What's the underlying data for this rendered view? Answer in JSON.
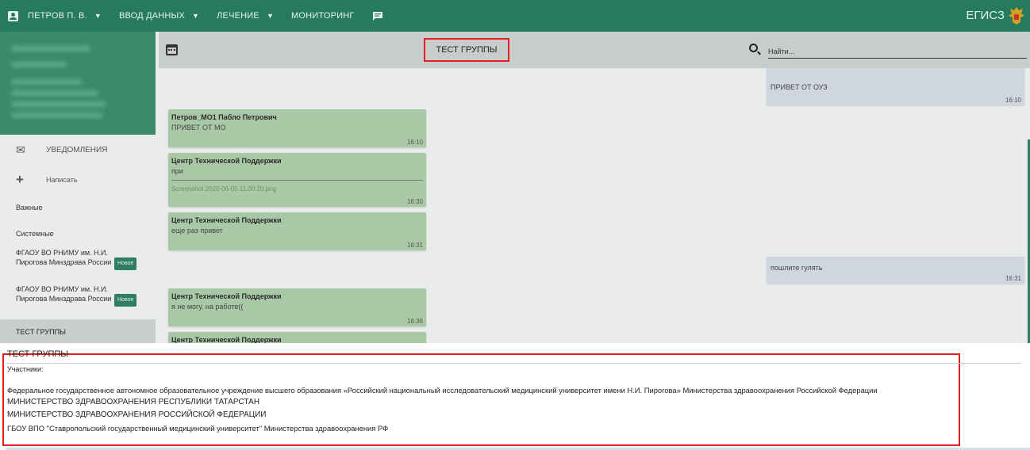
{
  "colors": {
    "nav": "#267a5e",
    "accent": "#2f7d62",
    "highlight": "#e02020",
    "incoming": "#a9c9a6",
    "outgoing": "#cfd6e0"
  },
  "nav": {
    "user": "ПЕТРОВ П. В.",
    "input": "ВВОД ДАННЫХ",
    "treatment": "ЛЕЧЕНИЕ",
    "monitoring": "МОНИТОРИНГ",
    "brand": "ЕГИСЗ",
    "icons": [
      "account-box-icon",
      "caret-down-icon",
      "chat-icon",
      "emblem-icon"
    ]
  },
  "sidebar": {
    "notifications": "УВЕДОМЛЕНИЯ",
    "compose": "Написать",
    "important": "Важные",
    "system": "Системные",
    "orgs": [
      {
        "name": "ФГАОУ ВО РНИМУ им. Н.И. Пирогова Минздрава России",
        "badge": "Новое"
      },
      {
        "name": "ФГАОУ ВО РНИМУ им. Н.И. Пирогова Минздрава России",
        "badge": "Новое"
      }
    ],
    "active": "ТЕСТ ГРУППЫ",
    "icons": [
      "mail-icon",
      "plus-icon"
    ]
  },
  "chat": {
    "title": "ТЕСТ ГРУППЫ",
    "search_placeholder": "Найти...",
    "messages": [
      {
        "dir": "out",
        "text": "ПРИВЕТ ОТ ОУЗ",
        "time": "16:10"
      },
      {
        "dir": "in",
        "sender": "Петров_МО1 Пабло Петрович",
        "text": "ПРИВЕТ ОТ МО",
        "time": "16:10"
      },
      {
        "dir": "in",
        "sender": "Центр Технической Поддержки",
        "text": "при",
        "attachment": "Screenshot 2020-06-05 11.00.20.png",
        "time": "16:30"
      },
      {
        "dir": "in",
        "sender": "Центр Технической Поддержки",
        "text": "еще раз привет",
        "time": "16:31"
      },
      {
        "dir": "out",
        "text": "пошлите гулять",
        "time": "16:31"
      },
      {
        "dir": "in",
        "sender": "Центр Технической Поддержки",
        "text": "я не могу. на работе((",
        "time": "16:36"
      },
      {
        "dir": "in",
        "sender": "Центр Технической Поддержки",
        "text": "",
        "time": ""
      }
    ]
  },
  "info": {
    "title": "ТЕСТ ГРУППЫ",
    "participants_label": "Участники:",
    "members": [
      "Федеральное государственное автономное образовательное учреждение высшего образования «Российский национальный исследовательский медицинский университет имени Н.И. Пирогова» Министерства здравоохранения Российской Федерации",
      "МИНИСТЕРСТВО ЗДРАВООХРАНЕНИЯ РЕСПУБЛИКИ ТАТАРСТАН",
      "МИНИСТЕРСТВО ЗДРАВООХРАНЕНИЯ РОССИЙСКОЙ ФЕДЕРАЦИИ",
      "ГБОУ ВПО \"Ставропольский государственный медицинский университет\" Министерства здравоохранения РФ"
    ]
  }
}
